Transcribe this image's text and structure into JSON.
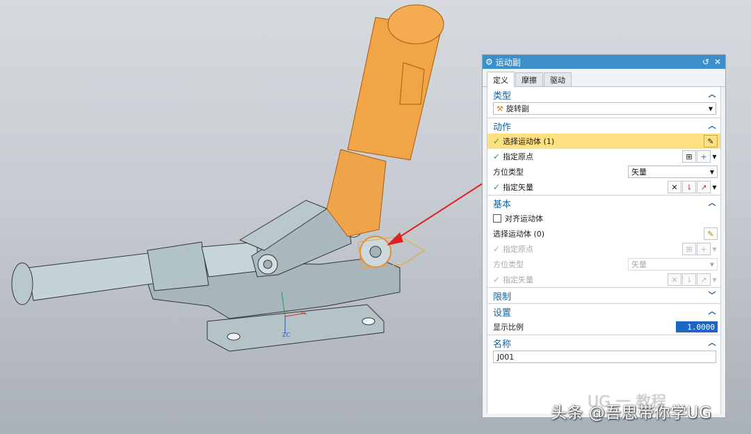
{
  "dialog": {
    "title": "运动副",
    "tabs": [
      {
        "label": "定义",
        "active": true
      },
      {
        "label": "摩擦",
        "active": false
      },
      {
        "label": "驱动",
        "active": false
      }
    ],
    "type_section": {
      "title": "类型",
      "value": "旋转副"
    },
    "action_section": {
      "title": "动作",
      "select_body": "选择运动体 (1)",
      "specify_origin": "指定原点",
      "orient_type_label": "方位类型",
      "orient_type_value": "矢量",
      "specify_vector": "指定矢量"
    },
    "base_section": {
      "title": "基本",
      "align_checkbox": "对齐运动体",
      "select_body": "选择运动体 (0)",
      "specify_origin": "指定原点",
      "orient_type_label": "方位类型",
      "orient_type_value": "矢量",
      "specify_vector": "指定矢量"
    },
    "limits_section": {
      "title": "限制"
    },
    "settings_section": {
      "title": "设置",
      "display_scale_label": "显示比例",
      "display_scale_value": "1.0000"
    },
    "name_section": {
      "title": "名称",
      "value": "J001"
    }
  },
  "viewport": {
    "axis_labels": {
      "xc": "XC",
      "zc": "ZC"
    }
  },
  "watermark": {
    "main": "头条 @吾思带你学UG",
    "faint": "UG 一 教程"
  },
  "colors": {
    "accent": "#3c8fc9",
    "highlight": "#fde080",
    "model_orange": "#f0a040",
    "model_grey": "#b7c6cc"
  }
}
